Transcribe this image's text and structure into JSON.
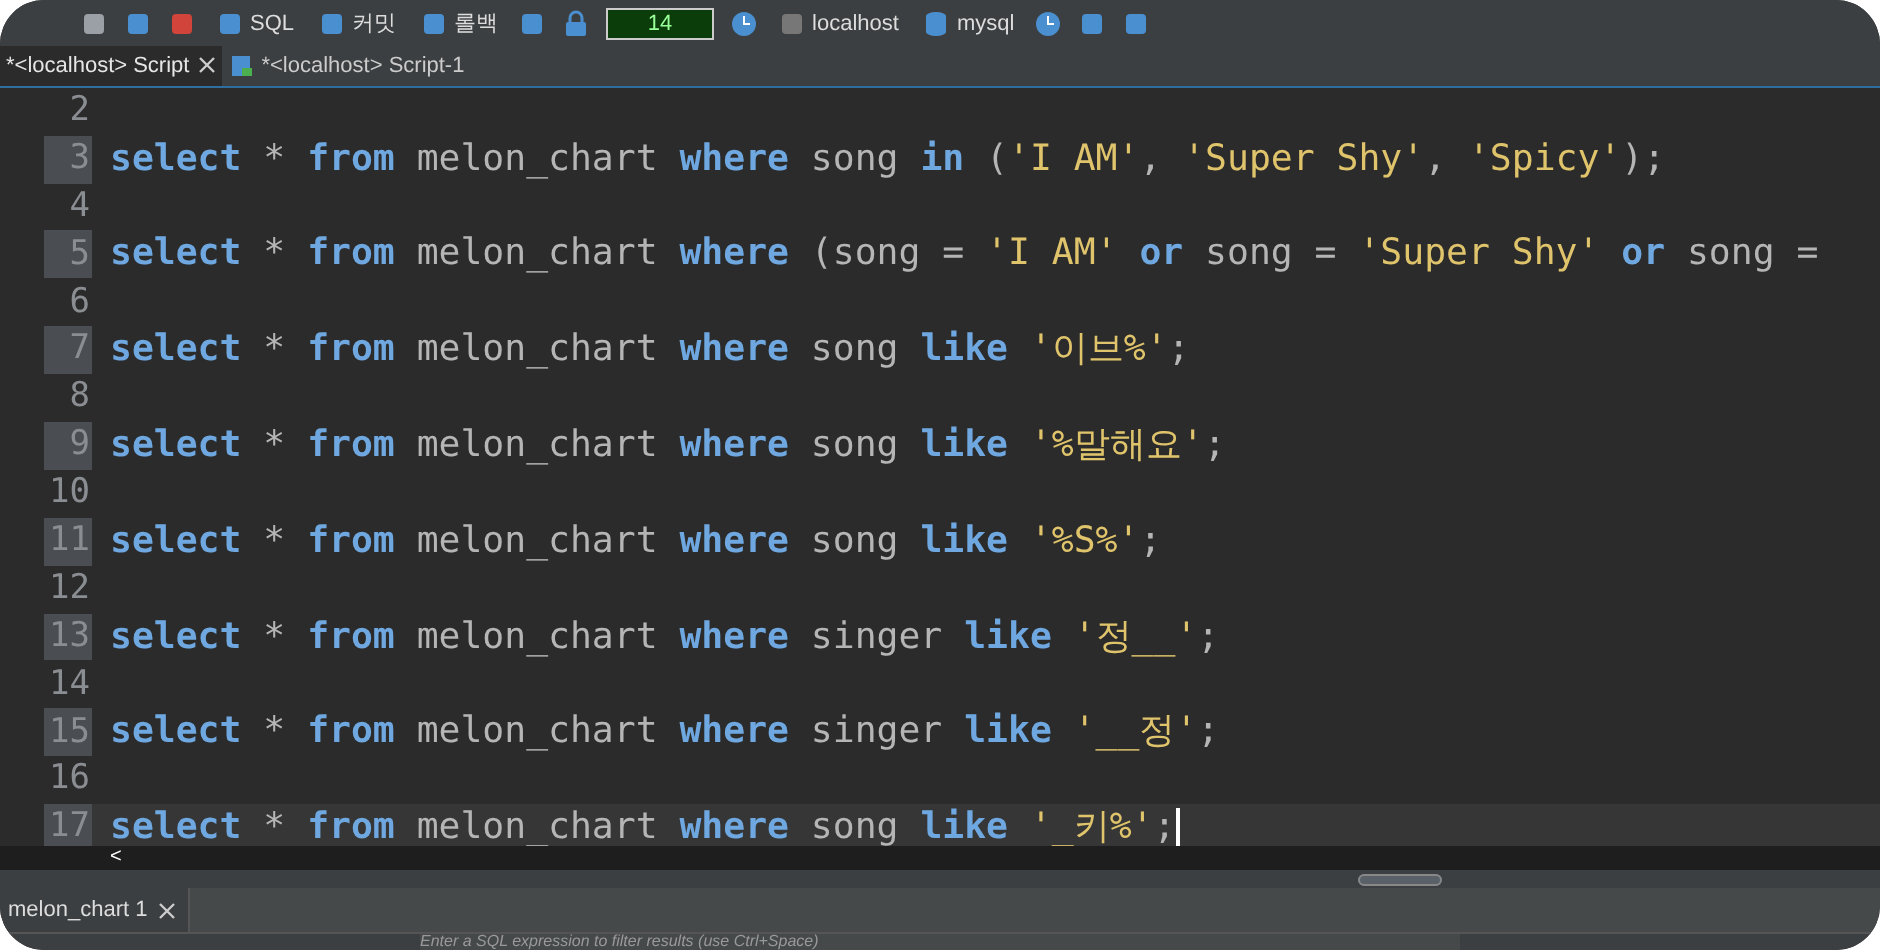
{
  "toolbar": {
    "items": [
      {
        "kind": "icon"
      },
      {
        "kind": "icon"
      },
      {
        "kind": "icon"
      },
      {
        "kind": "button",
        "label": "SQL"
      },
      {
        "kind": "button",
        "label": "커밋"
      },
      {
        "kind": "button",
        "label": "롤백"
      },
      {
        "kind": "icon"
      },
      {
        "kind": "icon"
      },
      {
        "kind": "field",
        "value": "14"
      },
      {
        "kind": "icon"
      },
      {
        "kind": "button",
        "label": "localhost"
      },
      {
        "kind": "button",
        "label": "mysql"
      },
      {
        "kind": "icon"
      },
      {
        "kind": "icon"
      },
      {
        "kind": "icon"
      }
    ]
  },
  "tabs": [
    {
      "label": "*<localhost> Script",
      "selected": true,
      "closable": true
    },
    {
      "label": "*<localhost> Script-1",
      "selected": false,
      "closable": false
    }
  ],
  "editor": {
    "lines": [
      {
        "number": "2"
      },
      {
        "number": "3",
        "tokens": [
          {
            "kind": "kw",
            "text": "select"
          },
          {
            "kind": "p",
            "text": " * "
          },
          {
            "kind": "kw",
            "text": "from"
          },
          {
            "kind": "p",
            "text": " melon_chart "
          },
          {
            "kind": "kw",
            "text": "where"
          },
          {
            "kind": "p",
            "text": " song "
          },
          {
            "kind": "kw",
            "text": "in"
          },
          {
            "kind": "p",
            "text": " ("
          },
          {
            "kind": "s",
            "text": "'I AM'"
          },
          {
            "kind": "p",
            "text": ", "
          },
          {
            "kind": "s",
            "text": "'Super Shy'"
          },
          {
            "kind": "p",
            "text": ", "
          },
          {
            "kind": "s",
            "text": "'Spicy'"
          },
          {
            "kind": "p",
            "text": ");"
          }
        ]
      },
      {
        "number": "4"
      },
      {
        "number": "5",
        "tokens": [
          {
            "kind": "kw",
            "text": "select"
          },
          {
            "kind": "p",
            "text": " * "
          },
          {
            "kind": "kw",
            "text": "from"
          },
          {
            "kind": "p",
            "text": " melon_chart "
          },
          {
            "kind": "kw",
            "text": "where"
          },
          {
            "kind": "p",
            "text": " (song = "
          },
          {
            "kind": "s",
            "text": "'I AM'"
          },
          {
            "kind": "kw",
            "text": " or"
          },
          {
            "kind": "p",
            "text": " song = "
          },
          {
            "kind": "s",
            "text": "'Super Shy'"
          },
          {
            "kind": "kw",
            "text": " or"
          },
          {
            "kind": "p",
            "text": " song ="
          }
        ]
      },
      {
        "number": "6"
      },
      {
        "number": "7",
        "tokens": [
          {
            "kind": "kw",
            "text": "select"
          },
          {
            "kind": "p",
            "text": " * "
          },
          {
            "kind": "kw",
            "text": "from"
          },
          {
            "kind": "p",
            "text": " melon_chart "
          },
          {
            "kind": "kw",
            "text": "where"
          },
          {
            "kind": "p",
            "text": " song "
          },
          {
            "kind": "kw",
            "text": "like"
          },
          {
            "kind": "s",
            "text": " '이브%'"
          },
          {
            "kind": "p",
            "text": ";"
          }
        ]
      },
      {
        "number": "8"
      },
      {
        "number": "9",
        "tokens": [
          {
            "kind": "kw",
            "text": "select"
          },
          {
            "kind": "p",
            "text": " * "
          },
          {
            "kind": "kw",
            "text": "from"
          },
          {
            "kind": "p",
            "text": " melon_chart "
          },
          {
            "kind": "kw",
            "text": "where"
          },
          {
            "kind": "p",
            "text": " song "
          },
          {
            "kind": "kw",
            "text": "like"
          },
          {
            "kind": "s",
            "text": " '%말해요'"
          },
          {
            "kind": "p",
            "text": ";"
          }
        ]
      },
      {
        "number": "10"
      },
      {
        "number": "11",
        "tokens": [
          {
            "kind": "kw",
            "text": "select"
          },
          {
            "kind": "p",
            "text": " * "
          },
          {
            "kind": "kw",
            "text": "from"
          },
          {
            "kind": "p",
            "text": " melon_chart "
          },
          {
            "kind": "kw",
            "text": "where"
          },
          {
            "kind": "p",
            "text": " song "
          },
          {
            "kind": "kw",
            "text": "like"
          },
          {
            "kind": "s",
            "text": " '%S%'"
          },
          {
            "kind": "p",
            "text": ";"
          }
        ]
      },
      {
        "number": "12"
      },
      {
        "number": "13",
        "tokens": [
          {
            "kind": "kw",
            "text": "select"
          },
          {
            "kind": "p",
            "text": " * "
          },
          {
            "kind": "kw",
            "text": "from"
          },
          {
            "kind": "p",
            "text": " melon_chart "
          },
          {
            "kind": "kw",
            "text": "where"
          },
          {
            "kind": "p",
            "text": " singer "
          },
          {
            "kind": "kw",
            "text": "like"
          },
          {
            "kind": "s",
            "text": " '정__'"
          },
          {
            "kind": "p",
            "text": ";"
          }
        ]
      },
      {
        "number": "14"
      },
      {
        "number": "15",
        "tokens": [
          {
            "kind": "kw",
            "text": "select"
          },
          {
            "kind": "p",
            "text": " * "
          },
          {
            "kind": "kw",
            "text": "from"
          },
          {
            "kind": "p",
            "text": " melon_chart "
          },
          {
            "kind": "kw",
            "text": "where"
          },
          {
            "kind": "p",
            "text": " singer "
          },
          {
            "kind": "kw",
            "text": "like"
          },
          {
            "kind": "s",
            "text": " '__정'"
          },
          {
            "kind": "p",
            "text": ";"
          }
        ]
      },
      {
        "number": "16"
      },
      {
        "number": "17",
        "current": true,
        "tokens": [
          {
            "kind": "kw",
            "text": "select"
          },
          {
            "kind": "p",
            "text": " * "
          },
          {
            "kind": "kw",
            "text": "from"
          },
          {
            "kind": "p",
            "text": " melon_chart "
          },
          {
            "kind": "kw",
            "text": "where"
          },
          {
            "kind": "p",
            "text": " song "
          },
          {
            "kind": "kw",
            "text": "like"
          },
          {
            "kind": "s",
            "text": " '_키%'"
          },
          {
            "kind": "p",
            "text": ";"
          }
        ]
      }
    ],
    "scroll_left": "<"
  },
  "results": {
    "tab": {
      "label": "melon_chart 1",
      "closable": true
    },
    "filter": {
      "placeholder": "Enter a SQL expression to filter results (use Ctrl+Space)"
    }
  }
}
